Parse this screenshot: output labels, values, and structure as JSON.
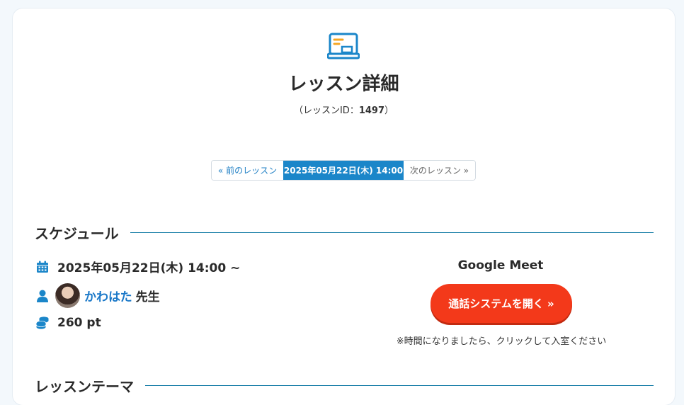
{
  "header": {
    "icon": "laptop-icon",
    "title": "レッスン詳細",
    "lesson_id_prefix": "（レッスンID：",
    "lesson_id": "1497",
    "lesson_id_suffix": "）"
  },
  "pager": {
    "prev_label": "« 前のレッスン",
    "current_label": "2025年05月22日(木) 14:00",
    "next_label": "次のレッスン »"
  },
  "schedule": {
    "heading": "スケジュール",
    "date_time": "2025年05月22日(木) 14:00 ~",
    "teacher_name": "かわはた",
    "teacher_suffix": "先生",
    "points": "260 pt",
    "call_system_label": "Google Meet",
    "open_button_label": "通話システムを開く »",
    "note": "※時間になりましたら、クリックして入室ください"
  },
  "theme": {
    "heading": "レッスンテーマ"
  },
  "colors": {
    "accent": "#1b86c9",
    "button": "#f3391a",
    "teacher_link": "#1a78c8"
  }
}
